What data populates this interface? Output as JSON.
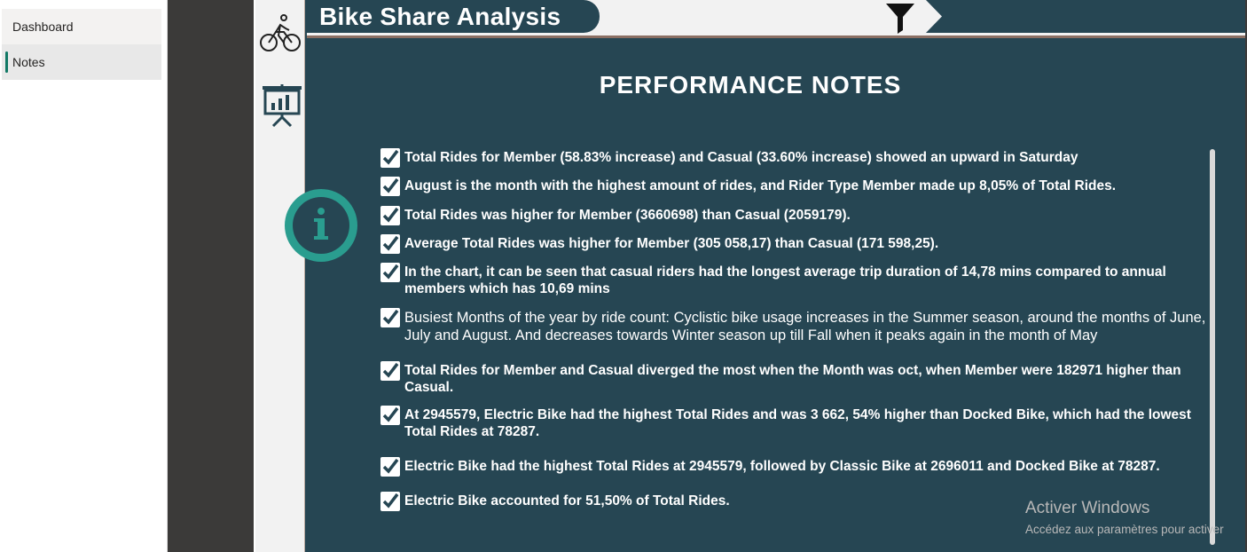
{
  "nav": {
    "items": [
      {
        "label": "Dashboard"
      },
      {
        "label": "Notes"
      }
    ]
  },
  "report": {
    "title": "Bike Share Analysis",
    "page_title": "PERFORMANCE NOTES",
    "colors": {
      "background": "#264653",
      "accent_teal": "#2a9d8f",
      "light": "#f2f2f2",
      "header_line": "#8b6f63"
    },
    "icons": [
      "bike-icon",
      "presentation-board-icon",
      "info-icon",
      "filter-icon",
      "checkbox-checked-icon"
    ],
    "notes": [
      {
        "text": "Total Rides for Member (58.83% increase) and Casual (33.60% increase) showed an upward in Saturday"
      },
      {
        "text": "August is the month with the highest amount of rides, and Rider Type Member made up 8,05% of Total Rides."
      },
      {
        "text": "Total Rides was higher for Member (3660698) than Casual (2059179)."
      },
      {
        "text": "Average Total Rides was higher for Member (305 058,17) than Casual (171 598,25)."
      },
      {
        "text": "In the chart, it can be seen that casual riders had the longest average trip duration of 14,78 mins compared to annual members which has 10,69 mins"
      },
      {
        "text": "Busiest Months of the year by ride count: Cyclistic bike usage increases in the Summer season, around the months of June, July and August. And decreases towards Winter season up till Fall when it peaks again in the month of May"
      },
      {
        "text": "Total Rides for Member and Casual diverged the most when the Month was oct, when Member were 182971 higher than Casual."
      },
      {
        "text": "At 2945579, Electric Bike had the highest Total Rides and was 3 662, 54% higher than Docked Bike, which had the lowest Total Rides at 78287."
      },
      {
        "text": "Electric Bike had the highest Total Rides at 2945579, followed by Classic Bike at 2696011 and Docked Bike at 78287."
      },
      {
        "text": "Electric Bike accounted for 51,50% of Total Rides."
      }
    ]
  },
  "watermark": {
    "line1": "Activer Windows",
    "line2": "Accédez aux paramètres pour activer"
  }
}
